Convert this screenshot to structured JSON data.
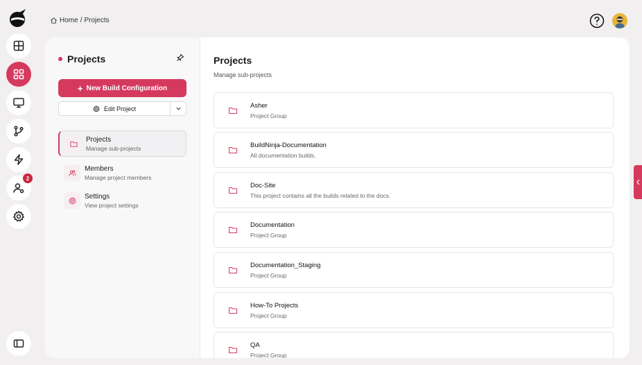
{
  "breadcrumb": {
    "home": "Home",
    "separator": "/",
    "current": "Projects"
  },
  "rail": {
    "icons": [
      "dashboard-icon",
      "projects-icon",
      "agents-icon",
      "git-branch-icon",
      "lightning-icon",
      "users-settings-icon",
      "settings-icon",
      "sidebar-toggle-icon"
    ],
    "notification_count": "2"
  },
  "sidebar": {
    "title": "Projects",
    "new_build_label": "New Build Configuration",
    "edit_project_label": "Edit Project",
    "nav": [
      {
        "label": "Projects",
        "sub": "Manage sub-projects"
      },
      {
        "label": "Members",
        "sub": "Manage project members"
      },
      {
        "label": "Settings",
        "sub": "View project settings"
      }
    ]
  },
  "main": {
    "title": "Projects",
    "subtitle": "Manage sub-projects",
    "projects": [
      {
        "name": "Asher",
        "desc": "Project Group"
      },
      {
        "name": "BuildNinja-Documentation",
        "desc": "All documentation builds."
      },
      {
        "name": "Doc-Site",
        "desc": "This project contains all the builds related to the docs."
      },
      {
        "name": "Documentation",
        "desc": "Project Group"
      },
      {
        "name": "Documentation_Staging",
        "desc": "Project Group"
      },
      {
        "name": "How-To Projects",
        "desc": "Project Group"
      },
      {
        "name": "QA",
        "desc": "Project Group"
      }
    ]
  },
  "colors": {
    "accent": "#d6395e",
    "background": "#f1eff0"
  }
}
